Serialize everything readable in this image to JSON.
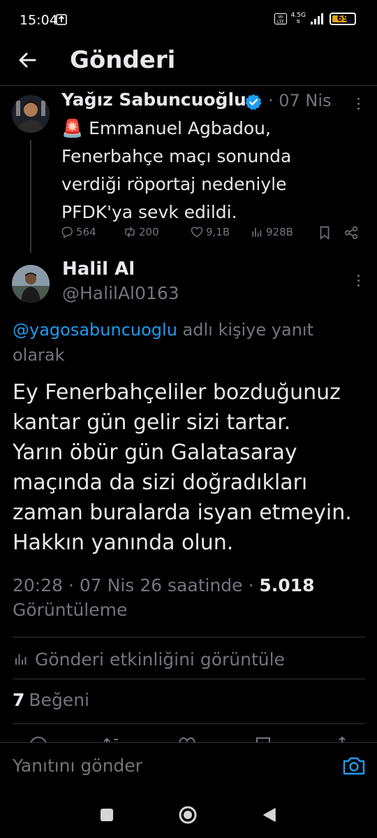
{
  "status_bar": {
    "time": "15:04",
    "network": "4.5G",
    "volte": "Vo LTE",
    "battery_level": "69",
    "battery_fraction": 0.69
  },
  "header": {
    "title": "Gönderi"
  },
  "parent_tweet": {
    "author_name": "Yağız Sabuncuoğlu",
    "date": "· 07 Nis",
    "text_lines": [
      "🚨 Emmanuel Agbadou,",
      "Fenerbahçe maçı sonunda",
      "verdiği röportaj nedeniyle",
      "PFDK'ya sevk edildi."
    ],
    "replies": "564",
    "retweets": "200",
    "likes": "9,1B",
    "views": "928B"
  },
  "reply": {
    "author_name": "Halil Al",
    "handle": "@HalilAl0163",
    "reply_to_mention": "@yagosabuncuoglu",
    "reply_to_suffix": " adlı kişiye yanıt olarak",
    "text_lines": [
      "Ey Fenerbahçeliler bozduğunuz",
      "kantar gün gelir sizi tartar.",
      "Yarın öbür gün Galatasaray",
      "maçında da sizi doğradıkları",
      "zaman buralarda isyan etmeyin.",
      "Hakkın yanında olun."
    ],
    "time": "20:28",
    "date": "· 07 Nis 26 saatinde ·",
    "views_count": "5.018",
    "views_label": "Görüntüleme",
    "activity_label": "Gönderi etkinliğini görüntüle",
    "likes_count": "7",
    "likes_label": "Beğeni"
  },
  "composer": {
    "placeholder": "Yanıtını gönder"
  },
  "colors": {
    "accent": "#1d9bf0",
    "muted": "#71767b",
    "divider": "#2f3336",
    "battery": "#e8a21a"
  }
}
